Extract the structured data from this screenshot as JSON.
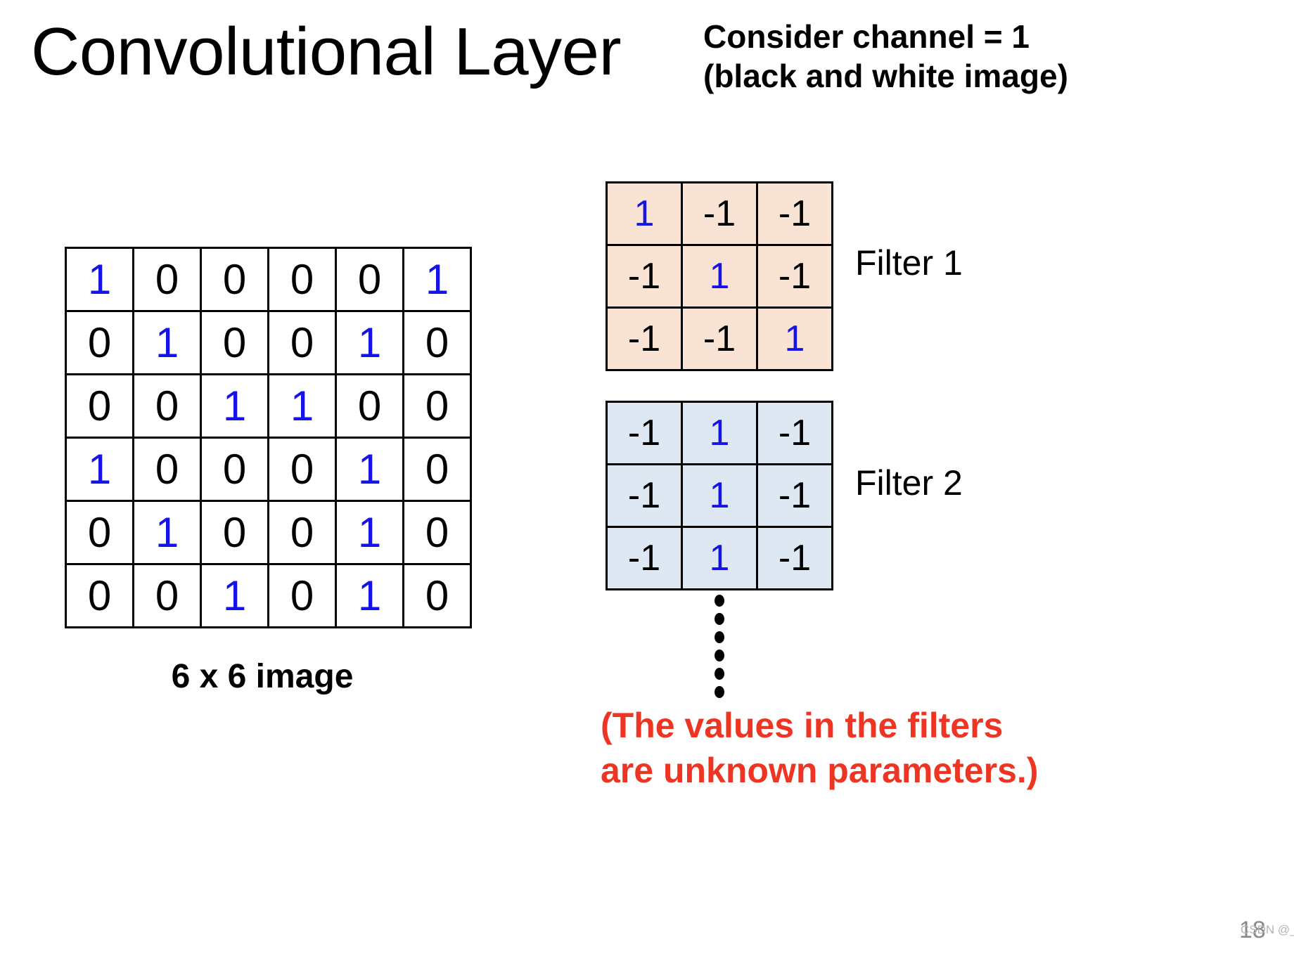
{
  "slide": {
    "title": "Convolutional Layer",
    "channel_note": [
      "Consider channel = 1",
      "(black and white image)"
    ],
    "image_caption": "6 x 6 image",
    "filter_note": [
      "(The values in the filters",
      "are unknown parameters.)"
    ],
    "page_number": "18",
    "watermark": "CSDN @_lofty"
  },
  "colors": {
    "one_value": "#1414E6",
    "zero_value": "#000000",
    "filter1_bg": "#F8E3D5",
    "filter2_bg": "#DEE8F2",
    "note_red": "#EE3524",
    "grid_line": "#000000"
  },
  "chart_data": {
    "type": "table",
    "title": "Convolutional Layer",
    "image_matrix": {
      "label": "6 x 6 image",
      "rows": 6,
      "cols": 6,
      "values": [
        [
          1,
          0,
          0,
          0,
          0,
          1
        ],
        [
          0,
          1,
          0,
          0,
          1,
          0
        ],
        [
          0,
          0,
          1,
          1,
          0,
          0
        ],
        [
          1,
          0,
          0,
          0,
          1,
          0
        ],
        [
          0,
          1,
          0,
          0,
          1,
          0
        ],
        [
          0,
          0,
          1,
          0,
          1,
          0
        ]
      ]
    },
    "filters": [
      {
        "label": "Filter 1",
        "rows": 3,
        "cols": 3,
        "background": "#F8E3D5",
        "values": [
          [
            1,
            -1,
            -1
          ],
          [
            -1,
            1,
            -1
          ],
          [
            -1,
            -1,
            1
          ]
        ]
      },
      {
        "label": "Filter 2",
        "rows": 3,
        "cols": 3,
        "background": "#DEE8F2",
        "values": [
          [
            -1,
            1,
            -1
          ],
          [
            -1,
            1,
            -1
          ],
          [
            -1,
            1,
            -1
          ]
        ]
      }
    ],
    "ellipsis_dots": 6
  }
}
